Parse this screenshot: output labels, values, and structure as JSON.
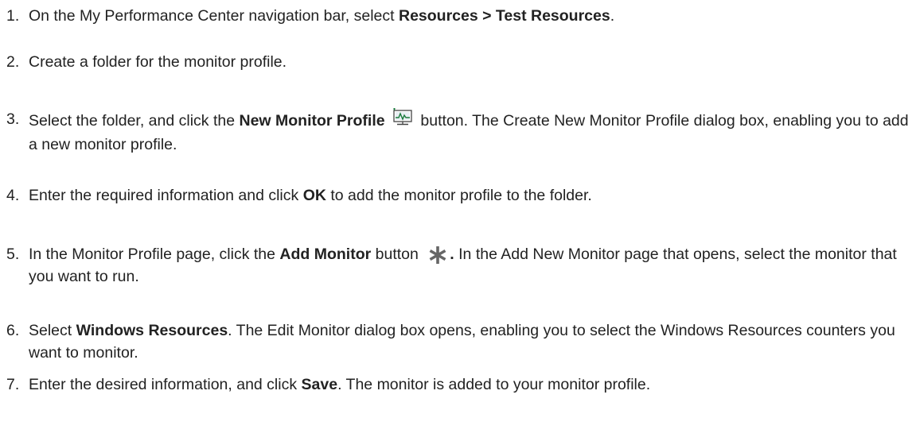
{
  "steps": [
    {
      "num": "1.",
      "parts": [
        {
          "t": "On the My Performance Center navigation bar, select "
        },
        {
          "t": "Resources > Test Resources",
          "b": true
        },
        {
          "t": "."
        }
      ]
    },
    {
      "num": "2.",
      "parts": [
        {
          "t": "Create a folder for the monitor profile."
        }
      ]
    },
    {
      "num": "3.",
      "parts": [
        {
          "t": "Select the folder, and click the "
        },
        {
          "t": "New Monitor Profile",
          "b": true
        },
        {
          "t": " "
        },
        {
          "icon": "new-monitor-profile-icon"
        },
        {
          "t": " button. The Create New Monitor Profile dialog box, enabling you to add a new monitor profile."
        }
      ]
    },
    {
      "num": "4.",
      "parts": [
        {
          "t": "Enter the required information and click "
        },
        {
          "t": "OK",
          "b": true
        },
        {
          "t": " to add the monitor profile to the folder."
        }
      ]
    },
    {
      "num": "5.",
      "parts": [
        {
          "t": "In the Monitor Profile page, click the "
        },
        {
          "t": "Add Monitor",
          "b": true
        },
        {
          "t": " button "
        },
        {
          "icon": "add-monitor-asterisk-icon"
        },
        {
          "t": ".",
          "b": true
        },
        {
          "t": " In the Add New Monitor page that opens, select the monitor that you want to run."
        }
      ]
    },
    {
      "num": "6.",
      "parts": [
        {
          "t": "Select "
        },
        {
          "t": "Windows Resources",
          "b": true
        },
        {
          "t": ". The Edit Monitor dialog box opens, enabling you to select the Windows Resources counters you want to monitor."
        }
      ]
    },
    {
      "num": "7.",
      "parts": [
        {
          "t": "Enter the desired information, and click "
        },
        {
          "t": "Save",
          "b": true
        },
        {
          "t": ". The monitor is added to your monitor profile."
        }
      ]
    }
  ]
}
